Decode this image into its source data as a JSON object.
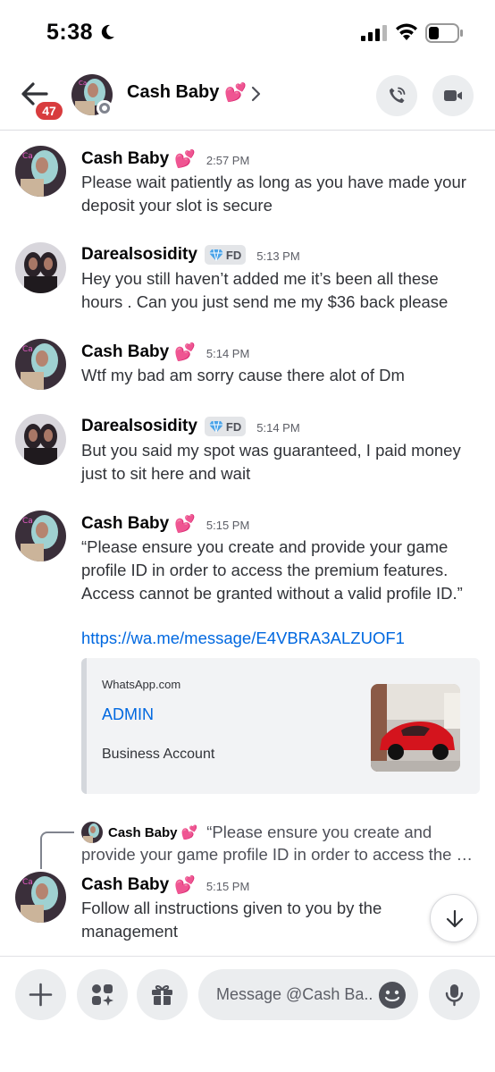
{
  "status_bar": {
    "time": "5:38"
  },
  "header": {
    "unread_count": "47",
    "title": "Cash Baby",
    "title_emoji": "💕"
  },
  "messages": [
    {
      "author": "Cash Baby",
      "author_emoji": "💕",
      "time": "2:57 PM",
      "text": "Please wait patiently as long as you have made your deposit your slot is secure"
    },
    {
      "author": "Darealsosidity",
      "badge": "FD",
      "time": "5:13 PM",
      "text": "Hey you still haven’t added me it’s been all these hours . Can you just send me my $36 back please"
    },
    {
      "author": "Cash Baby",
      "author_emoji": "💕",
      "time": "5:14 PM",
      "text": "Wtf my bad am sorry cause there alot of Dm"
    },
    {
      "author": "Darealsosidity",
      "badge": "FD",
      "time": "5:14 PM",
      "text": "But you said my spot was guaranteed, I paid money just to sit here and wait"
    },
    {
      "author": "Cash Baby",
      "author_emoji": "💕",
      "time": "5:15 PM",
      "text": "“Please ensure you create and provide your game profile ID in order to access the premium features. Access cannot be granted without a valid profile ID.”",
      "link": "https://wa.me/message/E4VBRA3ALZUOF1",
      "embed": {
        "provider": "WhatsApp.com",
        "title": "ADMIN",
        "description": "Business Account"
      }
    },
    {
      "author": "Cash Baby",
      "author_emoji": "💕",
      "time": "5:15 PM",
      "text": "Follow all instructions given to you by the management",
      "reply": {
        "author": "Cash Baby",
        "author_emoji": "💕",
        "preview_line1": "“Please ensure you create and",
        "preview_line2": "provide your game profile ID in order to access the …"
      }
    }
  ],
  "composer": {
    "placeholder": "Message @Cash Ba..."
  },
  "icons": {
    "back": "arrow-left-icon",
    "call": "phone-call-icon",
    "video": "video-camera-icon",
    "plus": "plus-icon",
    "apps": "apps-icon",
    "gift": "gift-icon",
    "emoji": "emoji-icon",
    "mic": "microphone-icon",
    "scroll": "arrow-down-icon"
  },
  "colors": {
    "accent_link": "#0068e0",
    "badge_red": "#d83c3e",
    "button_bg": "#ebedef"
  }
}
